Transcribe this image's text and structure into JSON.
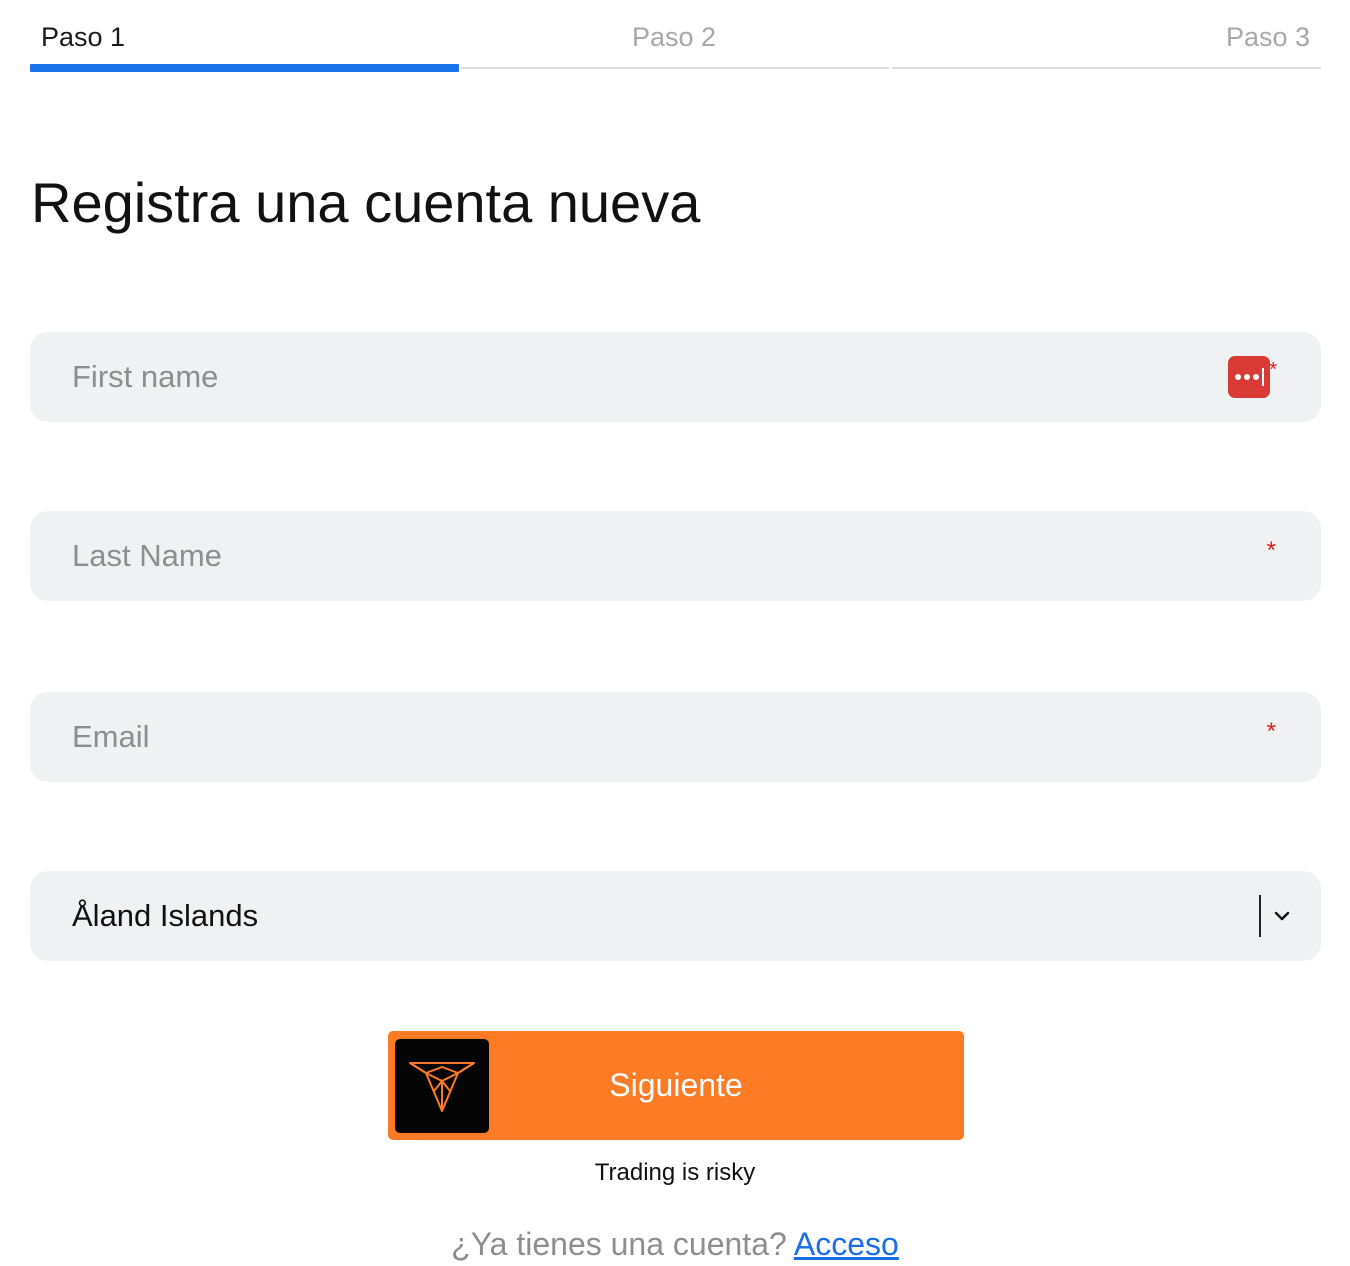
{
  "stepper": {
    "steps": [
      {
        "label": "Paso 1",
        "state": "active"
      },
      {
        "label": "Paso 2",
        "state": "inactive"
      },
      {
        "label": "Paso 3",
        "state": "inactive"
      }
    ],
    "active_color": "#1a73e8"
  },
  "form": {
    "title": "Registra una cuenta nueva",
    "first_name": {
      "placeholder": "First name",
      "value": "",
      "required_mark": "*",
      "autofill_icon": "password-manager-icon"
    },
    "last_name": {
      "placeholder": "Last Name",
      "value": "",
      "required_mark": "*"
    },
    "email": {
      "placeholder": "Email",
      "value": "",
      "required_mark": "*"
    },
    "country": {
      "selected": "Åland Islands",
      "icon": "chevron-down-icon"
    }
  },
  "submit": {
    "label": "Siguiente",
    "color": "#fd7b25",
    "logo_icon": "bull-head-logo-icon"
  },
  "disclaimer": "Trading is risky",
  "login": {
    "prompt": "¿Ya tienes una cuenta?",
    "link_label": "Acceso",
    "link_color": "#1a6ee8"
  }
}
